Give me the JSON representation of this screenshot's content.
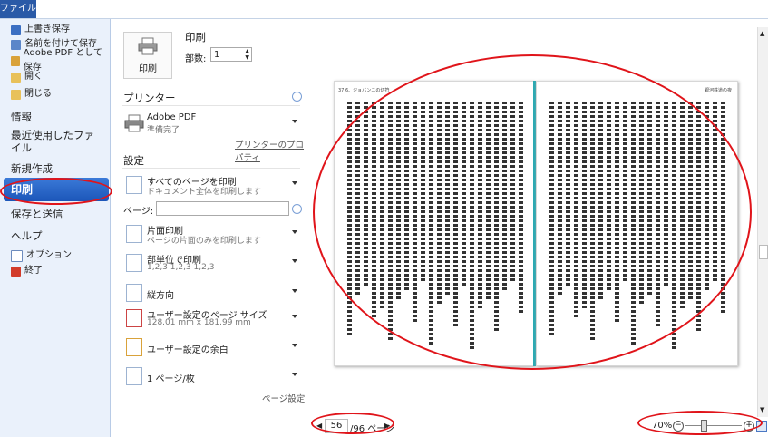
{
  "ribbon": {
    "file_tab": "ファイル"
  },
  "nav": {
    "small_items": [
      {
        "label": "上書き保存",
        "icon": "save-icon"
      },
      {
        "label": "名前を付けて保存",
        "icon": "save-as-icon"
      },
      {
        "label": "Adobe PDF として保存",
        "icon": "pdf-icon"
      },
      {
        "label": "開く",
        "icon": "open-folder-icon"
      },
      {
        "label": "閉じる",
        "icon": "close-folder-icon"
      }
    ],
    "info": "情報",
    "recent": "最近使用したファイル",
    "new": "新規作成",
    "print": "印刷",
    "save_send": "保存と送信",
    "help": "ヘルプ",
    "options": "オプション",
    "exit": "終了"
  },
  "print_panel": {
    "title": "印刷",
    "print_button": "印刷",
    "copies_label": "部数:",
    "copies_value": "1",
    "printer_title": "プリンター",
    "printer_name": "Adobe PDF",
    "printer_status": "準備完了",
    "printer_properties": "プリンターのプロパティ",
    "settings_title": "設定",
    "pages_label": "ページ:",
    "pages_value": "",
    "settings": [
      {
        "t1": "すべてのページを印刷",
        "t2": "ドキュメント全体を印刷します"
      },
      {
        "t1": "片面印刷",
        "t2": "ページの片面のみを印刷します"
      },
      {
        "t1": "部単位で印刷",
        "t2": "1,2,3    1,2,3    1,2,3"
      },
      {
        "t1": "縦方向",
        "t2": ""
      },
      {
        "t1": "ユーザー設定のページ サイズ",
        "t2": "128.01 mm x 181.99 mm"
      },
      {
        "t1": "ユーザー設定の余白",
        "t2": ""
      },
      {
        "t1": "1 ページ/枚",
        "t2": ""
      }
    ],
    "page_setup": "ページ設定"
  },
  "preview": {
    "left_header": "37  6、ジョバンニの切符",
    "right_header": "銀河鉄道の夜"
  },
  "bottom": {
    "current_page": "56",
    "total_pages": "/96 ページ",
    "zoom": "70%"
  },
  "colors": {
    "accent": "#2a5aa7",
    "annotation": "#e0141a",
    "spine": "#2aa9b2"
  }
}
